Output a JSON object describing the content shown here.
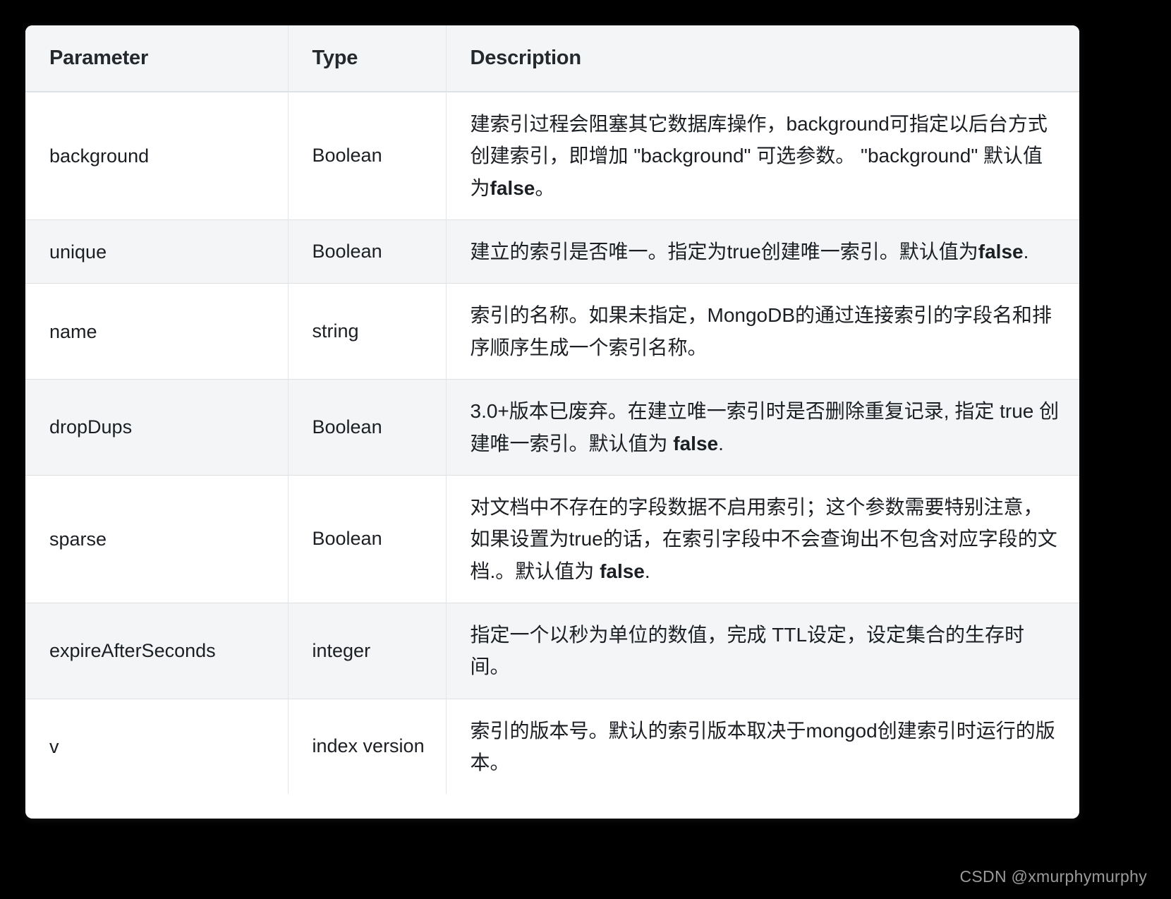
{
  "table": {
    "columns": [
      "Parameter",
      "Type",
      "Description"
    ],
    "rows": [
      {
        "parameter": "background",
        "type": "Boolean",
        "description_parts": [
          {
            "text": "建索引过程会阻塞其它数据库操作，background可指定以后台方式创建索引，即增加 \"background\" 可选参数。 \"background\" 默认值为",
            "bold": false
          },
          {
            "text": "false",
            "bold": true
          },
          {
            "text": "。",
            "bold": false
          }
        ]
      },
      {
        "parameter": "unique",
        "type": "Boolean",
        "description_parts": [
          {
            "text": "建立的索引是否唯一。指定为true创建唯一索引。默认值为",
            "bold": false
          },
          {
            "text": "false",
            "bold": true
          },
          {
            "text": ".",
            "bold": false
          }
        ]
      },
      {
        "parameter": "name",
        "type": "string",
        "description_parts": [
          {
            "text": "索引的名称。如果未指定，MongoDB的通过连接索引的字段名和排序顺序生成一个索引名称。",
            "bold": false
          }
        ]
      },
      {
        "parameter": "dropDups",
        "type": "Boolean",
        "description_parts": [
          {
            "text": "3.0+版本已废弃。在建立唯一索引时是否删除重复记录, 指定 true 创建唯一索引。默认值为 ",
            "bold": false
          },
          {
            "text": "false",
            "bold": true
          },
          {
            "text": ".",
            "bold": false
          }
        ]
      },
      {
        "parameter": "sparse",
        "type": "Boolean",
        "description_parts": [
          {
            "text": "对文档中不存在的字段数据不启用索引；这个参数需要特别注意，如果设置为true的话，在索引字段中不会查询出不包含对应字段的文档.。默认值为 ",
            "bold": false
          },
          {
            "text": "false",
            "bold": true
          },
          {
            "text": ".",
            "bold": false
          }
        ]
      },
      {
        "parameter": "expireAfterSeconds",
        "type": "integer",
        "description_parts": [
          {
            "text": "指定一个以秒为单位的数值，完成 TTL设定，设定集合的生存时间。",
            "bold": false
          }
        ]
      },
      {
        "parameter": "v",
        "type": "index version",
        "description_parts": [
          {
            "text": "索引的版本号。默认的索引版本取决于mongod创建索引时运行的版本。",
            "bold": false
          }
        ]
      }
    ]
  },
  "watermark": {
    "text": "CSDN @xmurphymurphy"
  },
  "colors": {
    "page_background": "#000000",
    "card_background": "#ffffff",
    "header_background": "#f4f5f6",
    "stripe_background": "#f4f5f6",
    "border": "#dfe2e5",
    "text": "#1b1f23",
    "watermark_text": "#9b9b9b"
  }
}
